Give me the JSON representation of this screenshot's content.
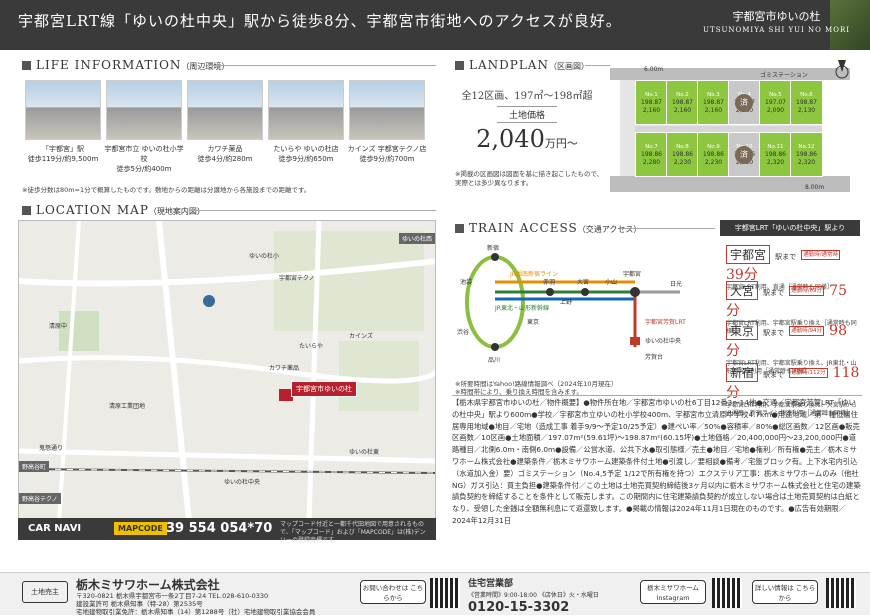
{
  "header": {
    "title": "宇都宮LRT線「ゆいの杜中央」駅から徒歩8分、宇都宮市街地へのアクセスが良好。",
    "brand_jp": "宇都宮市ゆいの杜",
    "brand_en": "UTSUNOMIYA SHI YUI NO MORI"
  },
  "life": {
    "title": "LIFE INFORMATION",
    "subtitle": "（周辺環境）",
    "places": [
      {
        "name": "「宇都宮」駅",
        "detail": "徒歩119分/約9,500m"
      },
      {
        "name": "宇都宮市立 ゆいの杜小学校",
        "detail": "徒歩5分/約400m"
      },
      {
        "name": "カワチ薬品",
        "detail": "徒歩4分/約280m"
      },
      {
        "name": "たいらや ゆいの杜店",
        "detail": "徒歩9分/約650m"
      },
      {
        "name": "カインズ 宇都宮テクノ店",
        "detail": "徒歩9分/約700m"
      }
    ],
    "note": "※徒歩分数は80m=1分で概算したものです。敷地からの距離は分譲地から各施設までの距離です。"
  },
  "location": {
    "title": "LOCATION MAP",
    "subtitle": "（現地案内図）",
    "target": "宇都宮市ゆいの杜",
    "station_tags": [
      "野高谷町",
      "野高谷テクノ",
      "ゆいの杜西"
    ],
    "labels": [
      "ゆいの杜小",
      "宇都宮テクノ",
      "カインズ",
      "たいらや",
      "カワチ薬品",
      "清原工業団地",
      "ゆいの杜東",
      "ゆいの杜中央",
      "鬼怒通り",
      "清原中"
    ],
    "car_navi": "CAR NAVI",
    "mapcode_label": "MAPCODE",
    "mapcode": "39 554 054*70",
    "mapcode_note": "マップコード付近と一都千代田地図で用意されるもので、「マップコード」および「MAPCODE」は(株)デンソーの登録商標です。"
  },
  "landplan": {
    "title": "LANDPLAN",
    "subtitle": "（区画図）",
    "lots_line": "全12区画、197㎡〜198㎡超",
    "price_label": "土地価格",
    "price": "2,040",
    "price_unit": "万円〜",
    "road_top": "6.00m",
    "road_side": "8.00m",
    "gomi": "ゴミステーション",
    "note1": "※掲載の区画図は図面を基に描き起こしたもので、",
    "note2": "実際とは多少異なります。",
    "lots_top": [
      {
        "num": "No.1",
        "area": "198.87",
        "price": "2,160",
        "sold": false
      },
      {
        "num": "No.2",
        "area": "198.87",
        "price": "2,160",
        "sold": false
      },
      {
        "num": "No.3",
        "area": "198.87",
        "price": "2,160",
        "sold": false
      },
      {
        "num": "No.4",
        "area": "198.87",
        "price": "2,160",
        "sold": true
      },
      {
        "num": "No.5",
        "area": "197.07",
        "price": "2,090",
        "sold": false
      },
      {
        "num": "No.6",
        "area": "198.87",
        "price": "2,130",
        "sold": false
      }
    ],
    "lots_bottom": [
      {
        "num": "No.7",
        "area": "198.86",
        "price": "2,280",
        "sold": false
      },
      {
        "num": "No.8",
        "area": "198.86",
        "price": "2,230",
        "sold": false
      },
      {
        "num": "No.9",
        "area": "198.86",
        "price": "2,230",
        "sold": false
      },
      {
        "num": "No.10",
        "area": "198.86",
        "price": "2,230",
        "sold": true
      },
      {
        "num": "No.11",
        "area": "198.86",
        "price": "2,320",
        "sold": false
      },
      {
        "num": "No.12",
        "area": "198.86",
        "price": "2,320",
        "sold": false
      }
    ],
    "sold_mark": "済"
  },
  "train": {
    "title": "TRAIN ACCESS",
    "subtitle": "（交通アクセス）",
    "stations": [
      "新宿",
      "池袋",
      "赤羽",
      "大宮",
      "東京",
      "品川",
      "小山",
      "宇都宮",
      "渋谷",
      "上野",
      "日光",
      "ゆいの杜中央",
      "芳賀台"
    ],
    "lines": [
      "JR湘南新宿ライン",
      "JR山手線",
      "JR東北・山形新幹線",
      "JR上野東京ライン直通・JR宇都宮線",
      "宇都宮芳賀LRT"
    ],
    "notes": [
      "※所要時間はYahoo!路線情報調べ（2024年10月現在）",
      "※時間帯により、乗り換え時間を含みます。",
      "※記載の所要時間は、通勤時（7:30〜9:00）、通常時（10:00〜12:00）に別途記載しています。"
    ],
    "badge": "宇都宮LRT「ゆいの杜中央」駅より",
    "access": [
      {
        "station": "宇都宮",
        "minutes": "39分",
        "tag": "通勤時/通常時",
        "sub": "宇都宮LRT利用、直通［通常時も同様］"
      },
      {
        "station": "大宮",
        "minutes": "75分",
        "tag": "通勤時/69分",
        "sub": "宇都宮LRT利用、宇都宮駅乗り換え［通常時も同様］"
      },
      {
        "station": "東京",
        "minutes": "98分",
        "tag": "通勤時/94分",
        "sub": "宇都宮LRT利用、宇都宮駅乗り換え、JR東北・山形新幹線利用［通常時も同様］"
      },
      {
        "station": "新宿",
        "minutes": "118分",
        "tag": "通勤時/112分",
        "sub": "宇都宮LRT利用、宇都宮駅乗り換え、大宮駅から JR湘南・新宿ライン快速利用［通常時も同様］"
      }
    ],
    "made": "駅まで"
  },
  "info_text": "【栃木県宇都宮市ゆいの杜／物件概要】●物件所在地／宇都宮市ゆいの杜6丁目12番3〜14他●交通／宇都宮芳賀LRT「ゆいの杜中央」駅より600m●学校／宇都宮市立ゆいの杜小学校400m、宇都宮市立清原中学校4.7km●用途地域／第一種低層住居専用地域●地目／宅地（造成工事 着手9/9〜予定10/25予定）●建ぺい率／50%●容積率／80%●総区画数／12区画●販売区画数／10区画●土地面積／197.07m²(59.61坪)〜198.87m²(60.15坪)●土地価格／20,400,000円〜23,200,000円●道路種目／北側6.0m・南側6.0m●設備／公営水道、公共下水●取引態様／売主●地目／宅地●権利／所有権●売主／栃木ミサワホーム株式会社●建築条件／栃木ミサワホーム建築条件付土地●引渡し／要相談●備考／宅盤ブロック有。上下水宅内引込（水道加入金）要）ゴミステーション（No.4,5予定 1/12で所有権を持つ）エクステリア工事：栃木ミサワホームのみ（他社NG）ガス引込：買主負担●建築条件付／この土地は土地売買契約締結後3ヶ月以内に栃木ミサワホーム株式会社と住宅の建築請負契約を締結することを条件として販売します。この期間内に住宅建築請負契約が成立しない場合は土地売買契約は白紙となり、受領した金銭は全額無利息にて返還致します。●掲載の情報は2024年11月1日現在のものです。●広告有効期限／2024年12月31日",
  "footer": {
    "seller_tag": "土地売主",
    "company": "栃木ミサワホーム株式会社",
    "address": "〒320-0821 栃木県宇都宮市一条2丁目7-24 TEL.028-610-0330",
    "license1": "建設業許可 栃木県知事（特-28）第2535号",
    "license2": "宅地建物取引業免許：栃木県知事（14）第1288号（社）宅地建物取引業協会会員",
    "contact_btn": "お問い合わせは こちらから",
    "sales_title": "住宅営業部",
    "hours": "《営業時間》9:00-18:00 《店休日》火・水曜日",
    "tel": "0120-15-3302",
    "insta_btn": "栃木ミサワホーム Instagram",
    "detail_btn": "詳しい情報は こちらから"
  }
}
